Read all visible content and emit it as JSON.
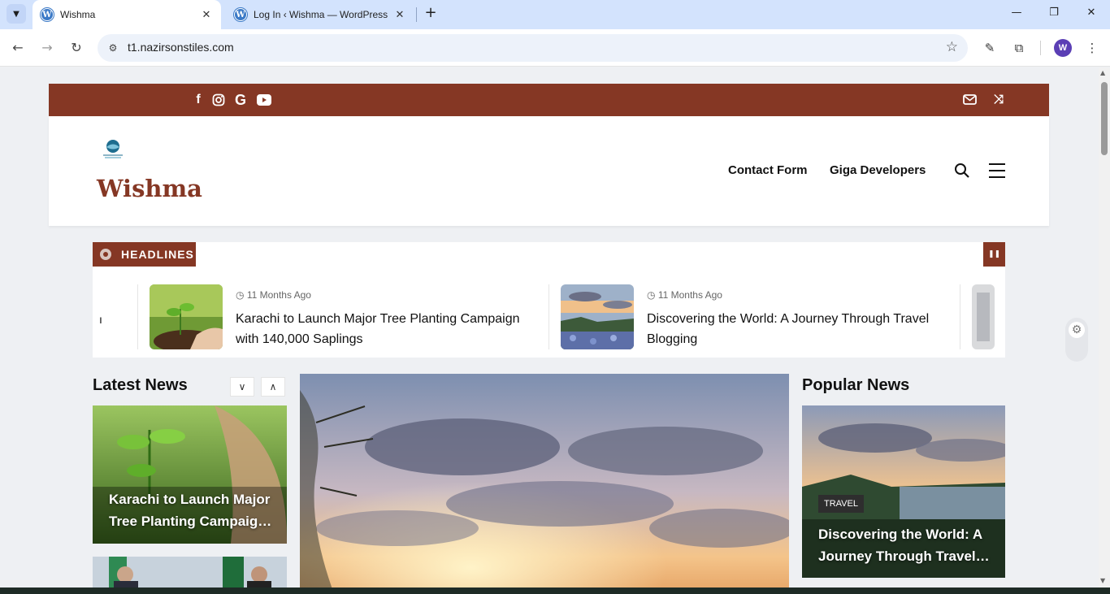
{
  "browser": {
    "tabs": [
      {
        "title": "Wishma",
        "favicon": "wordpress-icon",
        "active": true
      },
      {
        "title": "Log In ‹ Wishma — WordPress",
        "favicon": "wordpress-icon",
        "active": false
      }
    ],
    "url": "t1.nazirsonstiles.com",
    "profile_initial": "W"
  },
  "site": {
    "title": "Wishma",
    "brand_color": "#853724",
    "logo_caption": "Travel Blog",
    "nav": [
      {
        "label": "Contact Form"
      },
      {
        "label": "Giga Developers"
      }
    ],
    "social_icons": [
      "facebook-icon",
      "instagram-icon",
      "google-icon",
      "youtube-icon"
    ]
  },
  "ticker": {
    "badge": "HEADLINES",
    "partial_left": "ı",
    "items": [
      {
        "meta": "11 Months Ago",
        "title": "Karachi to Launch Major Tree Planting Campaign with 140,000 Saplings"
      },
      {
        "meta": "11 Months Ago",
        "title": "Discovering the World: A Journey Through Travel Blogging"
      }
    ]
  },
  "latest": {
    "heading": "Latest News",
    "cards": [
      {
        "title": "Karachi to Launch Major Tree Planting Campaig…"
      }
    ]
  },
  "popular": {
    "heading": "Popular News",
    "cards": [
      {
        "category": "TRAVEL",
        "title": "Discovering the World: A Journey Through Travel…"
      }
    ]
  }
}
